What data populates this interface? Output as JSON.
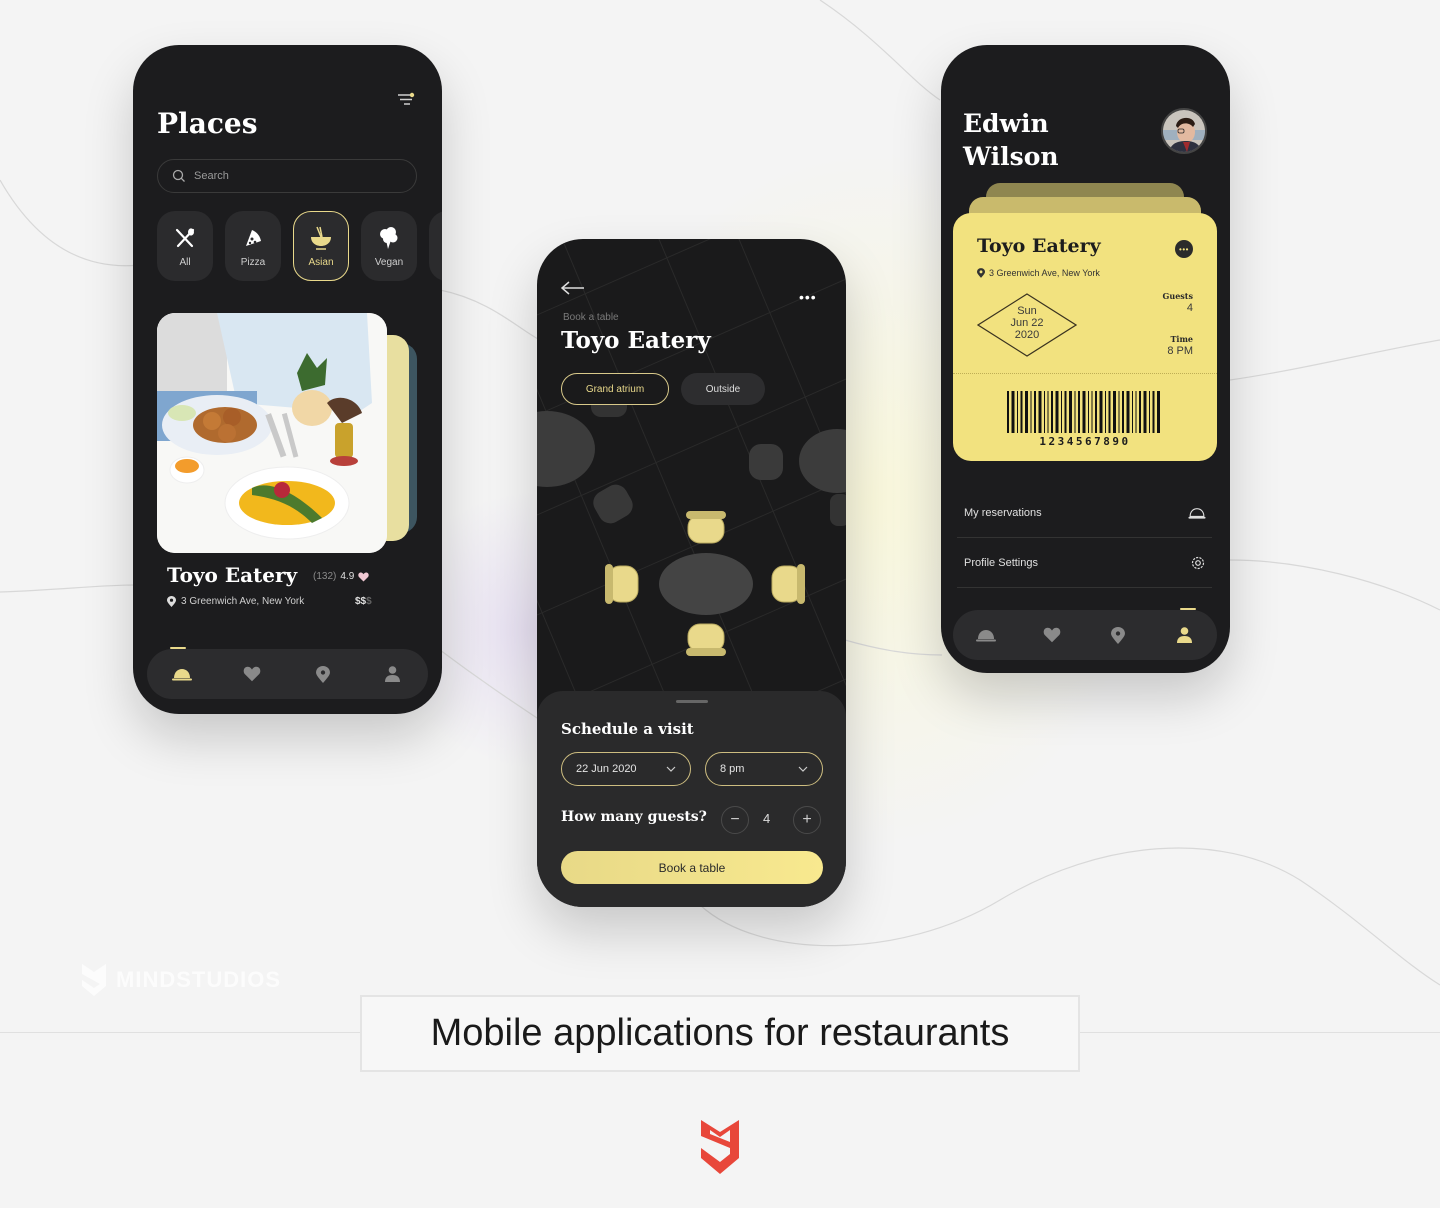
{
  "colors": {
    "accent": "#e9d98b",
    "ticket": "#f2e27f",
    "phone_bg": "#1c1c1e",
    "brand_red": "#e8473a",
    "page_bg": "#f4f4f4"
  },
  "places_screen": {
    "title": "Places",
    "filter_icon": "filter-icon",
    "search": {
      "placeholder": "Search",
      "value": ""
    },
    "categories": [
      {
        "label": "All",
        "icon": "cutlery-icon",
        "active": false
      },
      {
        "label": "Pizza",
        "icon": "pizza-icon",
        "active": false
      },
      {
        "label": "Asian",
        "icon": "bowl-chopsticks-icon",
        "active": true
      },
      {
        "label": "Vegan",
        "icon": "broccoli-icon",
        "active": false
      }
    ],
    "restaurant": {
      "name": "Toyo Eatery",
      "reviews": "(132)",
      "rating": "4.9",
      "address": "3 Greenwich Ave, New York",
      "price_active": "$$",
      "price_inactive": "$"
    },
    "tabbar": [
      "cloche-icon",
      "heart-icon",
      "location-icon",
      "user-icon"
    ],
    "active_tab": 0
  },
  "booking_screen": {
    "subtitle": "Book a table",
    "title": "Toyo Eatery",
    "areas": [
      {
        "label": "Grand atrium",
        "active": true
      },
      {
        "label": "Outside",
        "active": false
      }
    ],
    "schedule_title": "Schedule a visit",
    "date": "22 Jun 2020",
    "time": "8 pm",
    "guests_label": "How many guests?",
    "guests": "4",
    "minus": "−",
    "plus": "+",
    "book_button": "Book a table"
  },
  "profile_screen": {
    "first_name": "Edwin",
    "last_name": "Wilson",
    "ticket": {
      "name": "Toyo Eatery",
      "address": "3 Greenwich Ave, New York",
      "day": "Sun",
      "date": "Jun 22",
      "year": "2020",
      "guests_label": "Guests",
      "guests": "4",
      "time_label": "Time",
      "time": "8 PM",
      "barcode": "1234567890",
      "more": "•••"
    },
    "menu": [
      {
        "label": "My reservations",
        "icon": "cloche-icon"
      },
      {
        "label": "Profile Settings",
        "icon": "gear-icon"
      }
    ],
    "tabbar": [
      "cloche-icon",
      "heart-icon",
      "location-icon",
      "user-icon"
    ],
    "active_tab": 3
  },
  "caption": "Mobile applications for restaurants",
  "watermark": "MINDSTUDIOS"
}
